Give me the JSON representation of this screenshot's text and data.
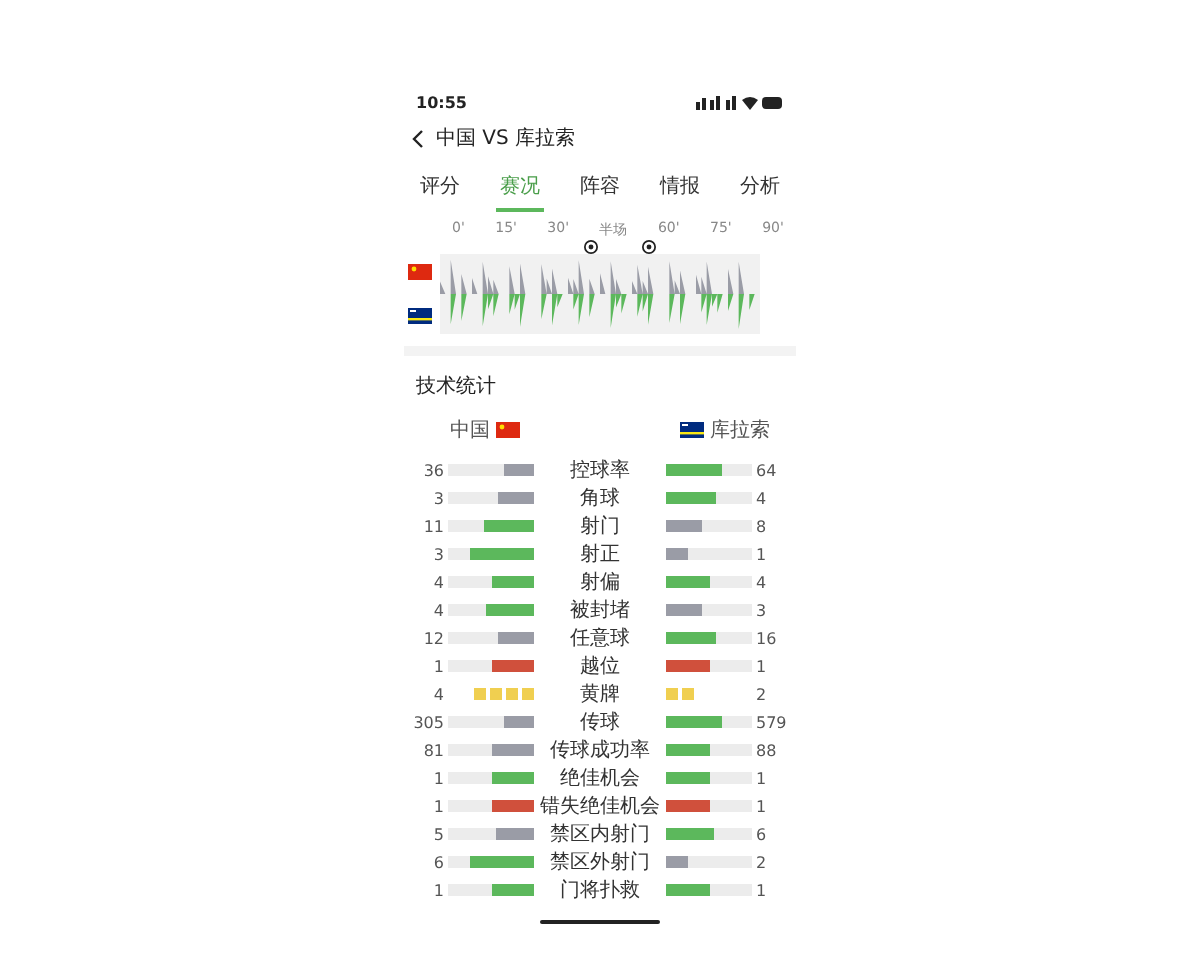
{
  "status_bar": {
    "time": "10:55"
  },
  "header": {
    "title": "中国 VS 库拉索"
  },
  "tabs": [
    {
      "label": "评分",
      "selected": false
    },
    {
      "label": "赛况",
      "selected": true
    },
    {
      "label": "阵容",
      "selected": false
    },
    {
      "label": "情报",
      "selected": false
    },
    {
      "label": "分析",
      "selected": false
    }
  ],
  "timeline": {
    "ticks": [
      "0'",
      "15'",
      "30'",
      "半场",
      "60'",
      "75'",
      "90'"
    ]
  },
  "stats": {
    "title": "技术统计",
    "home": "中国",
    "away": "库拉索",
    "rows": [
      {
        "kind": "bar",
        "label": "控球率",
        "left": {
          "value": "36",
          "level": 0.35,
          "color": "#9a9ca6"
        },
        "right": {
          "value": "64",
          "level": 0.65,
          "color": "#5cb85c"
        }
      },
      {
        "kind": "bar",
        "label": "角球",
        "left": {
          "value": "3",
          "level": 0.43,
          "color": "#9a9ca6"
        },
        "right": {
          "value": "4",
          "level": 0.57,
          "color": "#5cb85c"
        }
      },
      {
        "kind": "bar",
        "label": "射门",
        "left": {
          "value": "11",
          "level": 0.58,
          "color": "#5cb85c"
        },
        "right": {
          "value": "8",
          "level": 0.42,
          "color": "#9a9ca6"
        }
      },
      {
        "kind": "bar",
        "label": "射正",
        "left": {
          "value": "3",
          "level": 0.75,
          "color": "#5cb85c"
        },
        "right": {
          "value": "1",
          "level": 0.25,
          "color": "#9a9ca6"
        }
      },
      {
        "kind": "bar",
        "label": "射偏",
        "left": {
          "value": "4",
          "level": 0.5,
          "color": "#5cb85c"
        },
        "right": {
          "value": "4",
          "level": 0.5,
          "color": "#5cb85c"
        }
      },
      {
        "kind": "bar",
        "label": "被封堵",
        "left": {
          "value": "4",
          "level": 0.57,
          "color": "#5cb85c"
        },
        "right": {
          "value": "3",
          "level": 0.43,
          "color": "#9a9ca6"
        }
      },
      {
        "kind": "bar",
        "label": "任意球",
        "left": {
          "value": "12",
          "level": 0.43,
          "color": "#9a9ca6"
        },
        "right": {
          "value": "16",
          "level": 0.57,
          "color": "#5cb85c"
        }
      },
      {
        "kind": "bar",
        "label": "越位",
        "left": {
          "value": "1",
          "level": 0.5,
          "color": "#d0503c"
        },
        "right": {
          "value": "1",
          "level": 0.5,
          "color": "#d0503c"
        }
      },
      {
        "kind": "cards",
        "label": "黄牌",
        "left": {
          "value": "4",
          "color": "#f0cf50"
        },
        "right": {
          "value": "2",
          "color": "#f0cf50"
        }
      },
      {
        "kind": "bar",
        "label": "传球",
        "left": {
          "value": "305",
          "level": 0.35,
          "color": "#9a9ca6"
        },
        "right": {
          "value": "579",
          "level": 0.65,
          "color": "#5cb85c"
        }
      },
      {
        "kind": "bar",
        "label": "传球成功率",
        "left": {
          "value": "81",
          "level": 0.48,
          "color": "#9a9ca6"
        },
        "right": {
          "value": "88",
          "level": 0.52,
          "color": "#5cb85c"
        }
      },
      {
        "kind": "bar",
        "label": "绝佳机会",
        "left": {
          "value": "1",
          "level": 0.5,
          "color": "#5cb85c"
        },
        "right": {
          "value": "1",
          "level": 0.5,
          "color": "#5cb85c"
        }
      },
      {
        "kind": "bar",
        "label": "错失绝佳机会",
        "left": {
          "value": "1",
          "level": 0.5,
          "color": "#d0503c"
        },
        "right": {
          "value": "1",
          "level": 0.5,
          "color": "#d0503c"
        }
      },
      {
        "kind": "bar",
        "label": "禁区内射门",
        "left": {
          "value": "5",
          "level": 0.45,
          "color": "#9a9ca6"
        },
        "right": {
          "value": "6",
          "level": 0.55,
          "color": "#5cb85c"
        }
      },
      {
        "kind": "bar",
        "label": "禁区外射门",
        "left": {
          "value": "6",
          "level": 0.75,
          "color": "#5cb85c"
        },
        "right": {
          "value": "2",
          "level": 0.25,
          "color": "#9a9ca6"
        }
      },
      {
        "kind": "bar",
        "label": "门将扑救",
        "left": {
          "value": "1",
          "level": 0.5,
          "color": "#5cb85c"
        },
        "right": {
          "value": "1",
          "level": 0.5,
          "color": "#5cb85c"
        }
      }
    ]
  }
}
